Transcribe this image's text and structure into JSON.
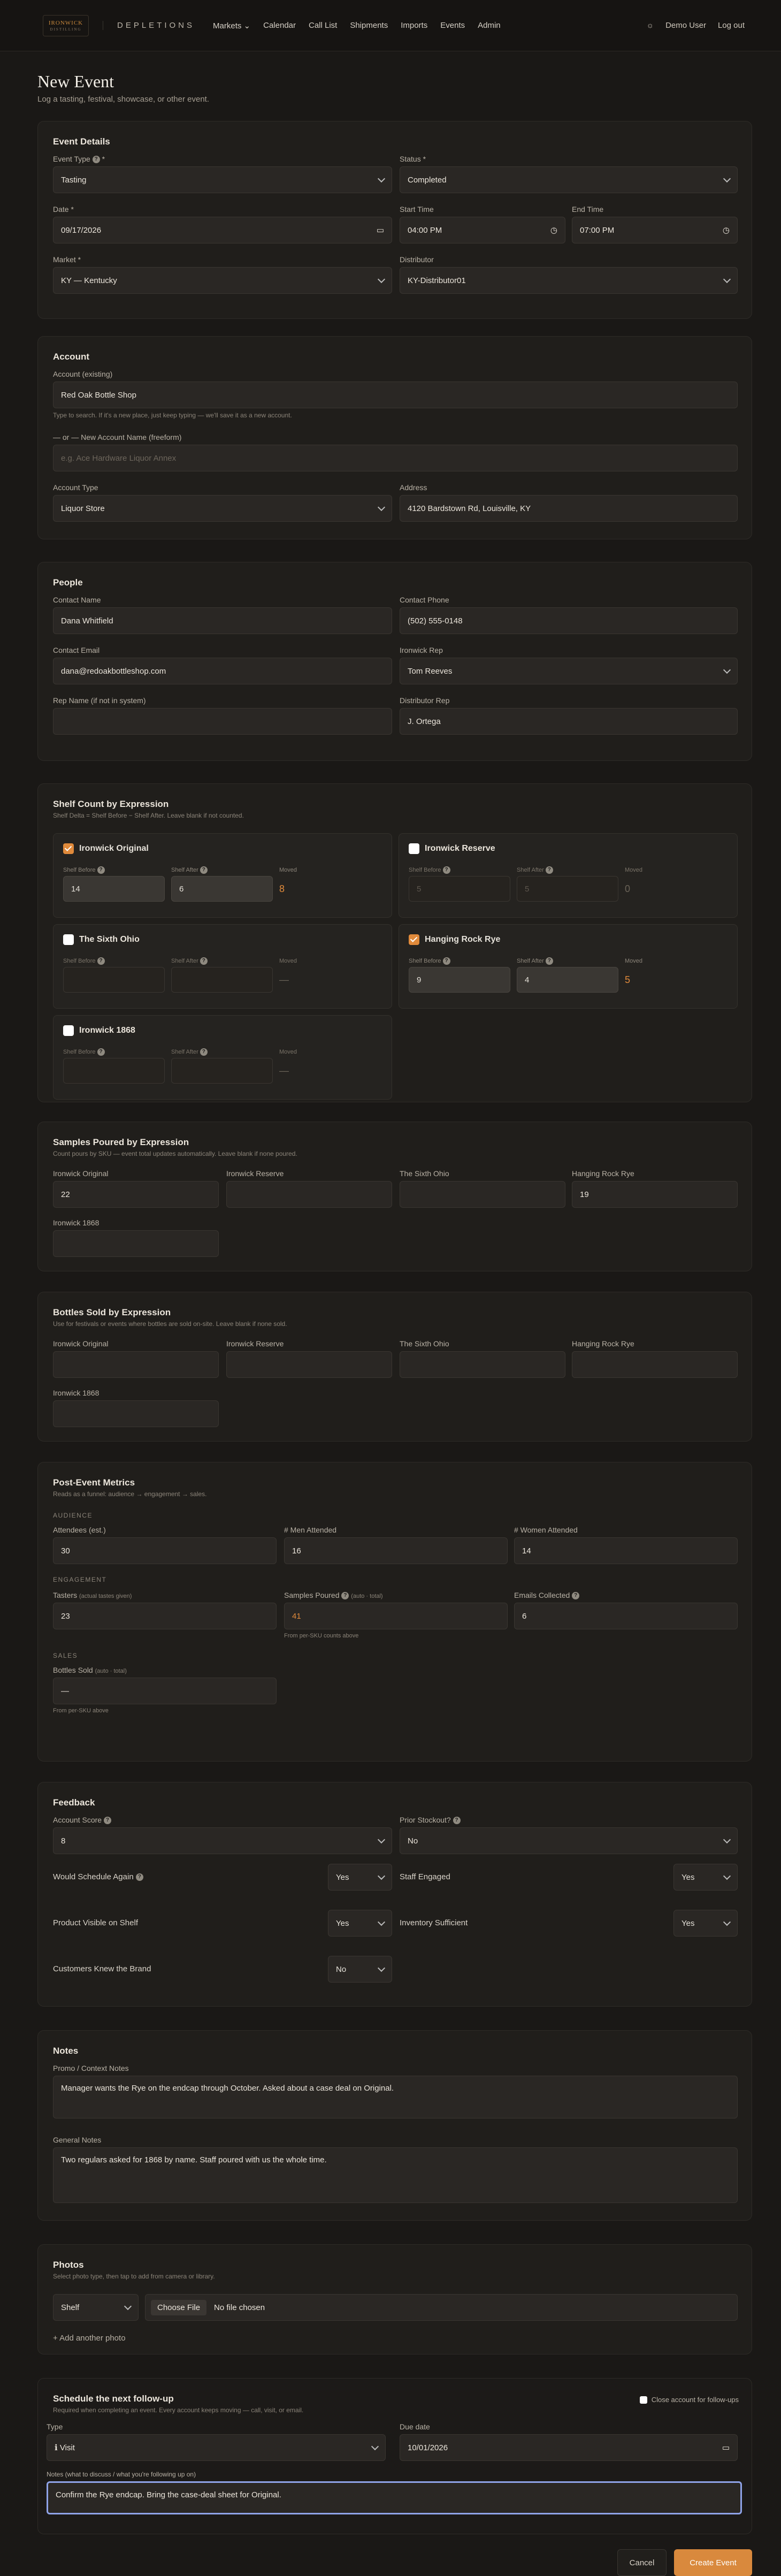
{
  "nav": {
    "logo": "IRONWICK",
    "logo_sub": "DISTILLING",
    "brand": "DEPLETIONS",
    "items": [
      "Markets",
      "Calendar",
      "Call List",
      "Shipments",
      "Imports",
      "Events",
      "Admin"
    ],
    "user": "Demo User",
    "logout": "Log out"
  },
  "page": {
    "title": "New Event",
    "subtitle": "Log a tasting, festival, showcase, or other event."
  },
  "details": {
    "title": "Event Details",
    "event_type_label": "Event Type",
    "event_type": "Tasting",
    "status_label": "Status *",
    "status": "Completed",
    "date_label": "Date *",
    "date": "09/17/2026",
    "start_label": "Start Time",
    "start": "04:00 PM",
    "end_label": "End Time",
    "end": "07:00 PM",
    "market_label": "Market *",
    "market": "KY — Kentucky",
    "distributor_label": "Distributor",
    "distributor": "KY-Distributor01"
  },
  "account": {
    "title": "Account",
    "existing_label": "Account (existing)",
    "existing": "Red Oak Bottle Shop",
    "hint": "Type to search. If it's a new place, just keep typing — we'll save it as a new account.",
    "new_label": "— or — New Account Name (freeform)",
    "new_placeholder": "e.g. Ace Hardware Liquor Annex",
    "type_label": "Account Type",
    "type": "Liquor Store",
    "address_label": "Address",
    "address": "4120 Bardstown Rd, Louisville, KY"
  },
  "people": {
    "title": "People",
    "contact_name_label": "Contact Name",
    "contact_name": "Dana Whitfield",
    "contact_phone_label": "Contact Phone",
    "contact_phone": "(502) 555-0148",
    "contact_email_label": "Contact Email",
    "contact_email": "dana@redoakbottleshop.com",
    "rep_label": "Ironwick Rep",
    "rep": "Tom Reeves",
    "rep_name_label": "Rep Name (if not in system)",
    "dist_rep_label": "Distributor Rep",
    "dist_rep": "J. Ortega"
  },
  "shelf": {
    "title": "Shelf Count by Expression",
    "hint": "Shelf Delta = Shelf Before − Shelf After. Leave blank if not counted.",
    "before": "Shelf Before",
    "after": "Shelf After",
    "moved": "Moved",
    "items": [
      {
        "name": "Ironwick Original",
        "before": "14",
        "after": "6",
        "moved": "8"
      },
      {
        "name": "Ironwick Reserve",
        "before": "5",
        "after": "5",
        "moved": "0"
      },
      {
        "name": "The Sixth Ohio",
        "before": "",
        "after": "",
        "moved": "—"
      },
      {
        "name": "Hanging Rock Rye",
        "before": "9",
        "after": "4",
        "moved": "5"
      },
      {
        "name": "Ironwick 1868",
        "before": "",
        "after": "",
        "moved": "—"
      }
    ]
  },
  "samples": {
    "title": "Samples Poured by Expression",
    "hint": "Count pours by SKU — event total updates automatically. Leave blank if none poured.",
    "labels": [
      "Ironwick Original",
      "Ironwick Reserve",
      "The Sixth Ohio",
      "Hanging Rock Rye",
      "Ironwick 1868"
    ],
    "values": [
      "22",
      "",
      "",
      "19",
      ""
    ]
  },
  "bottles": {
    "title": "Bottles Sold by Expression",
    "hint": "Use for festivals or events where bottles are sold on-site. Leave blank if none sold.",
    "labels": [
      "Ironwick Original",
      "Ironwick Reserve",
      "The Sixth Ohio",
      "Hanging Rock Rye",
      "Ironwick 1868"
    ]
  },
  "metrics": {
    "title": "Post-Event Metrics",
    "hint": "Reads as a funnel: audience → engagement → sales.",
    "audience": "AUDIENCE",
    "attendees_label": "Attendees (est.)",
    "attendees": "30",
    "men_label": "# Men Attended",
    "men": "16",
    "women_label": "# Women Attended",
    "women": "14",
    "engagement": "ENGAGEMENT",
    "tasters_label": "Tasters",
    "tasters_note": "(actual tastes given)",
    "tasters": "23",
    "samples_label": "Samples Poured",
    "samples_note": "(auto · total)",
    "samples": "41",
    "samples_from": "From per‑SKU counts above",
    "emails_label": "Emails Collected",
    "emails": "6",
    "sales": "SALES",
    "bottles_label": "Bottles Sold",
    "bottles_note": "(auto · total)",
    "bottles": "—",
    "bottles_from": "From per‑SKU above"
  },
  "feedback": {
    "title": "Feedback",
    "score_label": "Account Score",
    "score": "8",
    "stockout_label": "Prior Stockout?",
    "stockout": "No",
    "q1": "Would Schedule Again",
    "a1": "Yes",
    "q2": "Staff Engaged",
    "a2": "Yes",
    "q3": "Product Visible on Shelf",
    "a3": "Yes",
    "q4": "Inventory Sufficient",
    "a4": "Yes",
    "q5": "Customers Knew the Brand",
    "a5": "No"
  },
  "notes": {
    "title": "Notes",
    "promo_label": "Promo / Context Notes",
    "promo": "Manager wants the Rye on the endcap through October. Asked about a case deal on Original.",
    "general_label": "General Notes",
    "general": "Two regulars asked for 1868 by name. Staff poured with us the whole time."
  },
  "photos": {
    "title": "Photos",
    "hint": "Select photo type, then tap to add from camera or library.",
    "type": "Shelf",
    "choose": "Choose File",
    "no_file": "No file chosen",
    "add": "+ Add another photo"
  },
  "followup": {
    "title": "Schedule the next follow-up",
    "hint": "Required when completing an event. Every account keeps moving — call, visit, or email.",
    "close_label": "Close account for follow-ups",
    "type_label": "Type",
    "type": "Visit",
    "type_icon": "ℹ",
    "due_label": "Due date",
    "due": "10/01/2026",
    "notes_label": "Notes (what to discuss / what you're following up on)",
    "notes": "Confirm the Rye endcap. Bring the case-deal sheet for Original."
  },
  "actions": {
    "cancel": "Cancel",
    "create": "Create Event"
  }
}
